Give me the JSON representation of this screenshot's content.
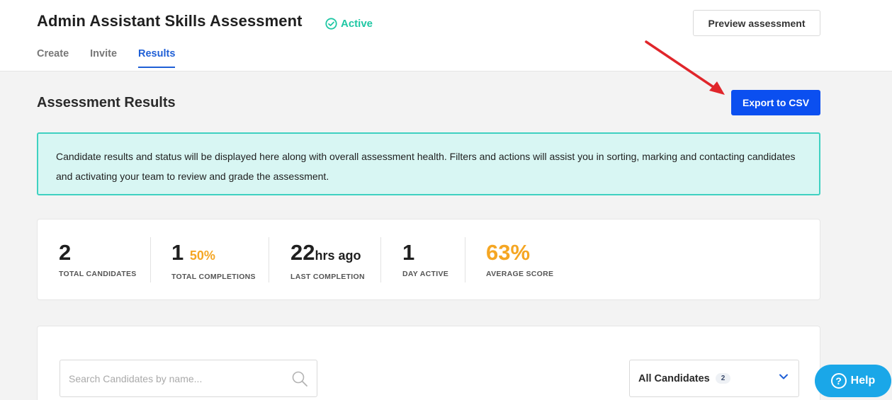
{
  "header": {
    "title": "Admin Assistant Skills Assessment",
    "status": "Active",
    "preview_label": "Preview assessment",
    "tabs": [
      {
        "label": "Create"
      },
      {
        "label": "Invite"
      },
      {
        "label": "Results",
        "active": true
      }
    ]
  },
  "main": {
    "section_title": "Assessment Results",
    "export_label": "Export to CSV",
    "info_text": "Candidate results and status will be displayed here along with overall assessment health. Filters and actions will assist you in sorting, marking and contacting candidates and activating your team to review and grade the assessment."
  },
  "stats": [
    {
      "value": "2",
      "sub": "",
      "label": "TOTAL CANDIDATES"
    },
    {
      "value": "1",
      "sub": "50%",
      "label": "TOTAL COMPLETIONS"
    },
    {
      "value": "22",
      "sub": "hrs ago",
      "label": "LAST COMPLETION"
    },
    {
      "value": "1",
      "sub": "",
      "label": "DAY ACTIVE"
    },
    {
      "value": "63%",
      "sub": "",
      "label": "AVERAGE SCORE"
    }
  ],
  "candidates": {
    "search_placeholder": "Search Candidates by name...",
    "filter_label": "All Candidates",
    "filter_count": "2"
  },
  "help": {
    "label": "Help"
  },
  "colors": {
    "accent": "#0b4ff0",
    "active_status": "#1fc7a4",
    "highlight": "#f5a623",
    "info_bg": "#d8f6f3",
    "help_bg": "#1aa7e8",
    "annotation_arrow": "#e0262b"
  },
  "icons": [
    "check-circle-icon",
    "search-icon",
    "chevron-down-icon",
    "question-icon",
    "annotation-arrow"
  ]
}
